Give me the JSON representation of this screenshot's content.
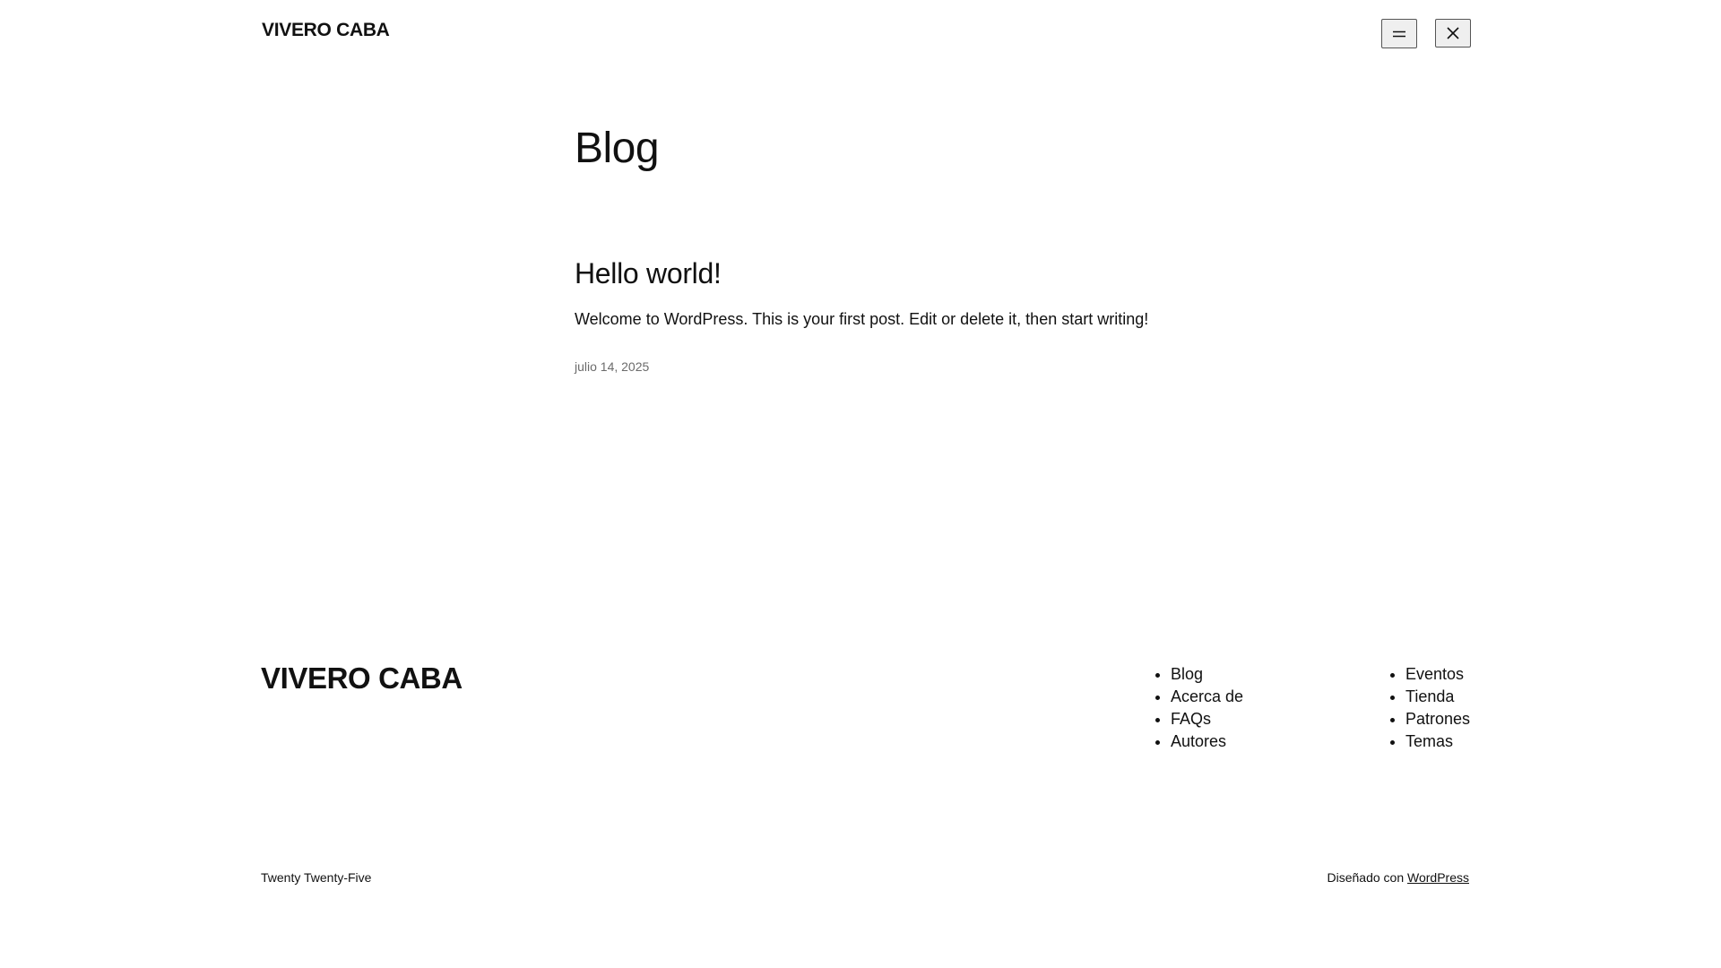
{
  "header": {
    "site_title": "VIVERO CABA",
    "menu_icon": "hamburger-menu-icon",
    "close_icon": "close-icon"
  },
  "main": {
    "page_title": "Blog",
    "posts": [
      {
        "title": "Hello world!",
        "excerpt": "Welcome to WordPress. This is your first post. Edit or delete it, then start writing!",
        "date": "julio 14, 2025"
      }
    ]
  },
  "footer": {
    "site_title": "VIVERO CABA",
    "nav_column_1": [
      "Blog",
      "Acerca de",
      "FAQs",
      "Autores"
    ],
    "nav_column_2": [
      "Eventos",
      "Tienda",
      "Patrones",
      "Temas"
    ],
    "theme_name": "Twenty Twenty-Five",
    "credit_prefix": "Diseñado con",
    "credit_link": "WordPress"
  }
}
